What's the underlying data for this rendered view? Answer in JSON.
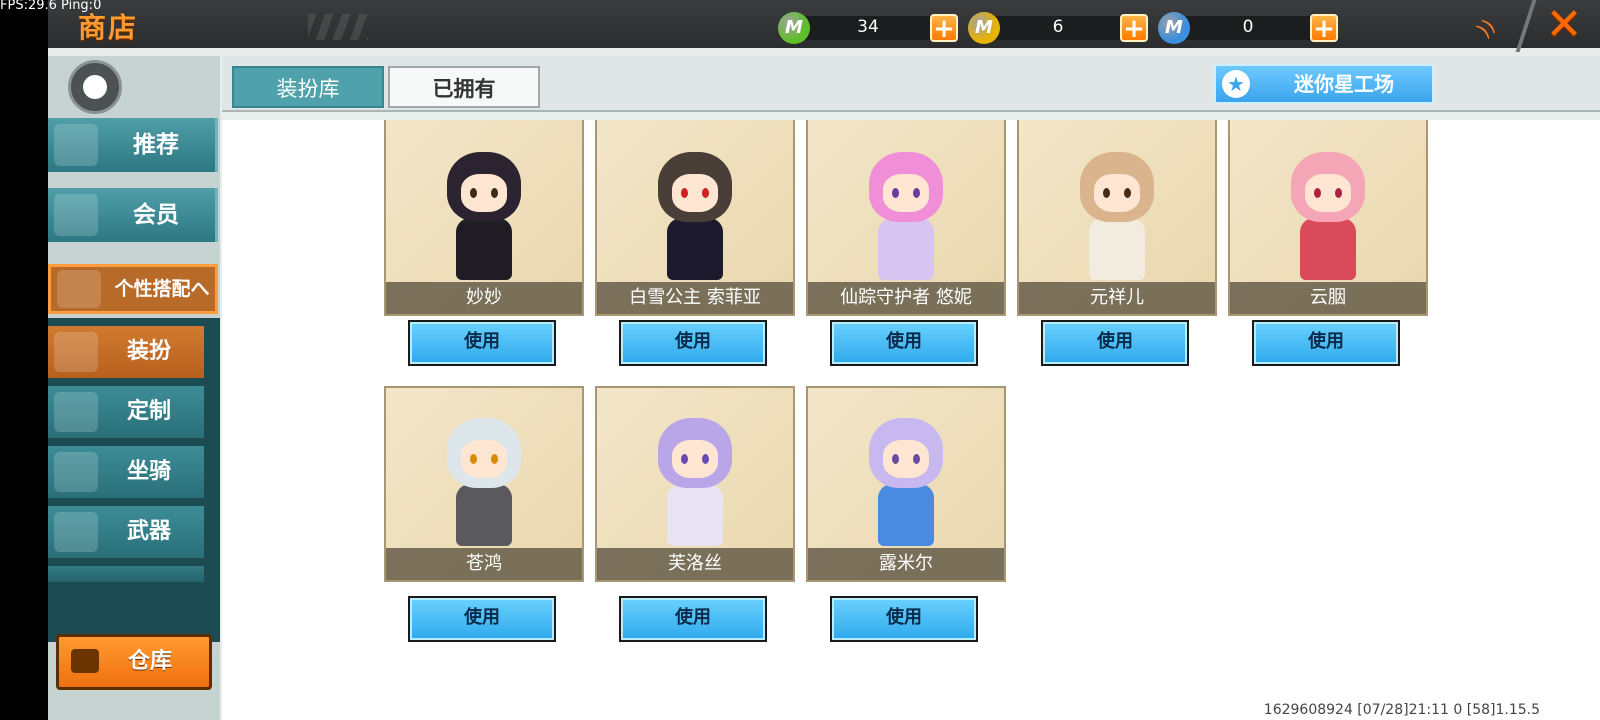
{
  "debug": {
    "fps_text": "FPS:29.6  Ping:0"
  },
  "header": {
    "title": "商店",
    "currencies": [
      {
        "icon": "green-gem-icon",
        "value": "34",
        "color": "#5fbf2a"
      },
      {
        "icon": "gold-coin-icon",
        "value": "6",
        "color": "#e8b400"
      },
      {
        "icon": "blue-coin-icon",
        "value": "0",
        "color": "#3a8fe0"
      }
    ],
    "plus_label": "+",
    "close_label": "✕"
  },
  "sidebar": {
    "items": [
      {
        "label": "推荐",
        "icon": "thumbs-up-icon"
      },
      {
        "label": "会员",
        "icon": "vip-icon"
      },
      {
        "label": "个性搭配へ",
        "icon": "trophy-icon"
      }
    ],
    "subitems": [
      {
        "label": "装扮",
        "icon": "outfit-icon",
        "active": true
      },
      {
        "label": "定制",
        "icon": "pencil-icon"
      },
      {
        "label": "坐骑",
        "icon": "mount-icon"
      },
      {
        "label": "武器",
        "icon": "gun-icon"
      }
    ],
    "warehouse_label": "仓库"
  },
  "tabs": [
    {
      "label": "装扮库",
      "active": true
    },
    {
      "label": "已拥有",
      "active": false
    }
  ],
  "workshop_label": "迷你星工场",
  "skins": [
    {
      "name": "妙妙",
      "button": "使用",
      "hair": "#2b2430",
      "outfit": "#1f1c24",
      "eye": "#3a2a1a"
    },
    {
      "name": "白雪公主 索菲亚",
      "button": "使用",
      "hair": "#4a3f38",
      "outfit": "#1e1a2e",
      "eye": "#d02020"
    },
    {
      "name": "仙踪守护者 悠妮",
      "button": "使用",
      "hair": "#f08fd8",
      "outfit": "#d8c4f0",
      "eye": "#6a3aa0"
    },
    {
      "name": "元祥儿",
      "button": "使用",
      "hair": "#d9b48c",
      "outfit": "#f2ece0",
      "eye": "#4a2a10"
    },
    {
      "name": "云胭",
      "button": "使用",
      "hair": "#f4a6b6",
      "outfit": "#d94a5a",
      "eye": "#b02040"
    },
    {
      "name": "苍鸿",
      "button": "使用",
      "hair": "#dde6ea",
      "outfit": "#5a5a5e",
      "eye": "#d88a00"
    },
    {
      "name": "芙洛丝",
      "button": "使用",
      "hair": "#b8a6e8",
      "outfit": "#e8e4f4",
      "eye": "#6a4ab0"
    },
    {
      "name": "露米尔",
      "button": "使用",
      "hair": "#c8b8f0",
      "outfit": "#4a8ae0",
      "eye": "#6a4aa0"
    }
  ],
  "footer": {
    "info": "1629608924   [07/28]21:11 0    [58]1.15.5"
  }
}
